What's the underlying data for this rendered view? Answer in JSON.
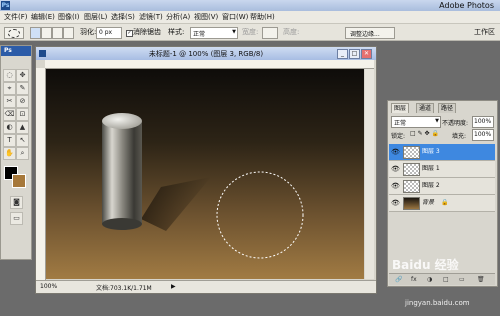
{
  "app": {
    "logo": "Ps",
    "title": "Adobe Photos"
  },
  "menu": [
    "文件(F)",
    "编辑(E)",
    "图像(I)",
    "图层(L)",
    "选择(S)",
    "滤镜(T)",
    "分析(A)",
    "视图(V)",
    "窗口(W)",
    "帮助(H)"
  ],
  "options": {
    "feather_label": "羽化:",
    "feather_value": "0 px",
    "antialias_label": "消除锯齿",
    "style_label": "样式:",
    "style_value": "正常",
    "width_label": "宽度:",
    "height_label": "高度:",
    "refine_edge": "调整边缘...",
    "workspace": "工作区"
  },
  "tools": {
    "logo": "Ps",
    "glyphs": [
      "◌",
      "✥",
      "⌖",
      "✎",
      "✂",
      "⊘",
      "⌫",
      "⊡",
      "◐",
      "▲",
      "T",
      "↖",
      "✋",
      "⌕"
    ]
  },
  "document": {
    "title": "未标题-1 @ 100% (图层 3, RGB/8)",
    "zoom": "100%",
    "doc_info": "文档:703.1K/1.71M",
    "min_btn": "_",
    "max_btn": "□",
    "close_btn": "✕"
  },
  "layers_panel": {
    "tabs": [
      "图层",
      "通道",
      "路径"
    ],
    "blend_mode": "正常",
    "opacity_label": "不透明度:",
    "opacity_value": "100%",
    "lock_label": "锁定:",
    "fill_label": "填充:",
    "fill_value": "100%",
    "layers": [
      {
        "name": "图层 3",
        "selected": true
      },
      {
        "name": "图层 1",
        "selected": false
      },
      {
        "name": "图层 2",
        "selected": false
      },
      {
        "name": "背景",
        "selected": false
      }
    ],
    "bottom_icons": [
      "🔗",
      "fx",
      "◑",
      "□",
      "▭",
      "🗑"
    ]
  },
  "watermark": {
    "main": "Baidu 经验",
    "url": "jingyan.baidu.com"
  },
  "colors": {
    "selected_row": "#3e88e0",
    "fg": "#000000",
    "bg": "#a6783a"
  }
}
